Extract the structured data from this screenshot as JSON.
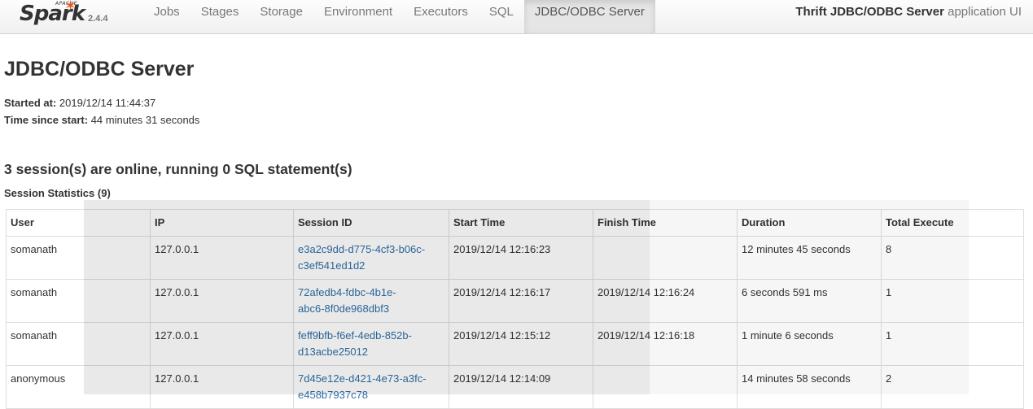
{
  "brand": {
    "apache": "APACHE",
    "name": "Spark",
    "version": "2.4.4"
  },
  "nav": {
    "tabs": [
      {
        "label": "Jobs"
      },
      {
        "label": "Stages"
      },
      {
        "label": "Storage"
      },
      {
        "label": "Environment"
      },
      {
        "label": "Executors"
      },
      {
        "label": "SQL"
      },
      {
        "label": "JDBC/ODBC Server",
        "active": true
      }
    ],
    "app_title_bold": "Thrift JDBC/ODBC Server",
    "app_title_rest": " application UI"
  },
  "page": {
    "title": "JDBC/ODBC Server",
    "started_at_label": "Started at:",
    "started_at_value": " 2019/12/14 11:44:37",
    "time_since_label": "Time since start:",
    "time_since_value": " 44 minutes 31 seconds",
    "sessions_heading": "3 session(s) are online, running 0 SQL statement(s)",
    "stats_heading": "Session Statistics (9)"
  },
  "table": {
    "headers": [
      "User",
      "IP",
      "Session ID",
      "Start Time",
      "Finish Time",
      "Duration",
      "Total Execute"
    ],
    "rows": [
      {
        "user": "somanath",
        "ip": "127.0.0.1",
        "session_id_1": "e3a2c9dd-d775-4cf3-b06c-",
        "session_id_2": "c3ef541ed1d2",
        "start": "2019/12/14 12:16:23",
        "finish": "",
        "duration": "12 minutes 45 seconds",
        "total": "8"
      },
      {
        "user": "somanath",
        "ip": "127.0.0.1",
        "session_id_1": "72afedb4-fdbc-4b1e-",
        "session_id_2": "abc6-8f0de968dbf3",
        "start": "2019/12/14 12:16:17",
        "finish": "2019/12/14 12:16:24",
        "duration": "6 seconds 591 ms",
        "total": "1"
      },
      {
        "user": "somanath",
        "ip": "127.0.0.1",
        "session_id_1": "feff9bfb-f6ef-4edb-852b-",
        "session_id_2": "d13acbe25012",
        "start": "2019/12/14 12:15:12",
        "finish": "2019/12/14 12:16:18",
        "duration": "1 minute 6 seconds",
        "total": "1"
      },
      {
        "user": "anonymous",
        "ip": "127.0.0.1",
        "session_id_1": "7d45e12e-d421-4e73-a3fc-",
        "session_id_2": "e458b7937c78",
        "start": "2019/12/14 12:14:09",
        "finish": "",
        "duration": "14 minutes 58 seconds",
        "total": "2"
      }
    ]
  },
  "colors": {
    "link": "#2f6fa7",
    "spark_star": "#e25a1c",
    "nav_bg": "#f7f7f7"
  }
}
